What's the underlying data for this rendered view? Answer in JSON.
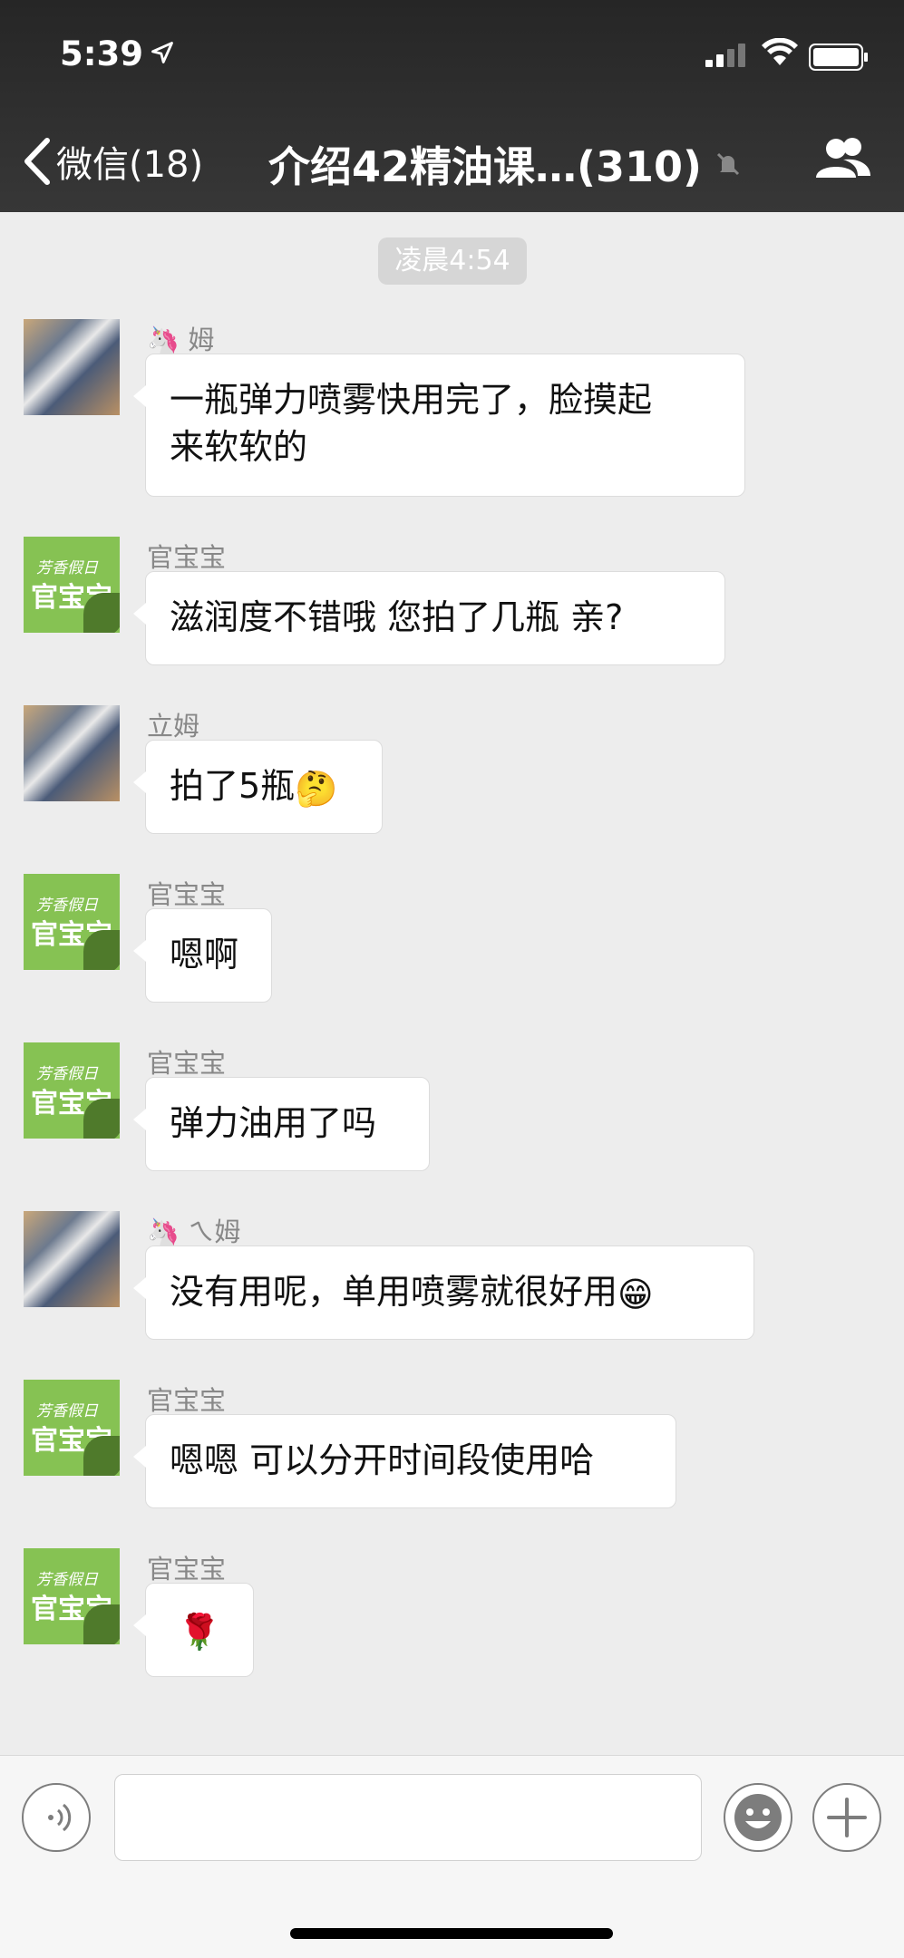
{
  "status_bar": {
    "time": "5:39"
  },
  "nav": {
    "back_label": "微信(18)",
    "title": "介绍42精油课…(310)"
  },
  "chat": {
    "timestamp": "凌晨4:54",
    "messages": [
      {
        "sender": "🦄 姆",
        "text": "一瓶弹力喷雾快用完了，脸摸起来软软的",
        "text_line1": "一瓶弹力喷雾快用完了，脸摸起",
        "text_line2": "来软软的",
        "avatar": "user"
      },
      {
        "sender": "官宝宝",
        "text": "滋润度不错哦 您拍了几瓶 亲?",
        "avatar": "guan"
      },
      {
        "sender": "立姆",
        "text": "拍了5瓶",
        "emoji": "🤔",
        "avatar": "user"
      },
      {
        "sender": "官宝宝",
        "text": "嗯啊",
        "avatar": "guan"
      },
      {
        "sender": "官宝宝",
        "text": "弹力油用了吗",
        "avatar": "guan"
      },
      {
        "sender": "🦄 ㄟ姆",
        "text": "没有用呢，单用喷雾就很好用",
        "emoji": "😁",
        "avatar": "user"
      },
      {
        "sender": "官宝宝",
        "text": "嗯嗯 可以分开时间段使用哈",
        "avatar": "guan"
      },
      {
        "sender": "官宝宝",
        "text": "",
        "emoji": "🌹",
        "avatar": "guan"
      }
    ],
    "guan_avatar_line1": "芳香假日",
    "guan_avatar_line2": "官宝宝"
  },
  "input_bar": {
    "placeholder": ""
  },
  "colors": {
    "topbar": "#2e2e2e",
    "chat_bg": "#ededed",
    "avatar_green": "#86c253"
  }
}
